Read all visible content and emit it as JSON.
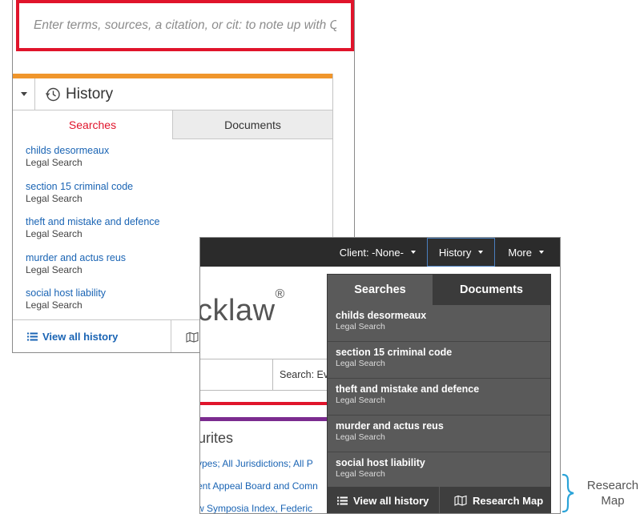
{
  "search": {
    "placeholder": "Enter terms, sources, a citation, or cit: to note up with Quic"
  },
  "history_panel": {
    "title": "History",
    "tabs": [
      {
        "label": "Searches",
        "active": true
      },
      {
        "label": "Documents",
        "active": false
      }
    ],
    "items": [
      {
        "name": "childs desormeaux",
        "type": "Legal Search"
      },
      {
        "name": "section 15 criminal code",
        "type": "Legal Search"
      },
      {
        "name": "theft and mistake and defence",
        "type": "Legal Search"
      },
      {
        "name": "murder and actus reus",
        "type": "Legal Search"
      },
      {
        "name": "social host liability",
        "type": "Legal Search"
      }
    ],
    "footer": {
      "view_all": "View all history"
    }
  },
  "header": {
    "client": "Client: -None-",
    "history": "History",
    "more": "More"
  },
  "background": {
    "logo_fragment": "cklaw",
    "logo_mark": "®",
    "search_scope": "Search: Ev",
    "favourites_title": "urites",
    "favourite_links": [
      "ypes; All Jurisdictions; All P",
      "ent Appeal Board and Comn",
      "w Symposia Index, Federic"
    ]
  },
  "dropdown": {
    "tabs": [
      {
        "label": "Searches",
        "active": true
      },
      {
        "label": "Documents",
        "active": false
      }
    ],
    "items": [
      {
        "name": "childs desormeaux",
        "type": "Legal Search"
      },
      {
        "name": "section 15 criminal code",
        "type": "Legal Search"
      },
      {
        "name": "theft and mistake and defence",
        "type": "Legal Search"
      },
      {
        "name": "murder and actus reus",
        "type": "Legal Search"
      },
      {
        "name": "social host liability",
        "type": "Legal Search"
      }
    ],
    "footer": {
      "view_all": "View all history",
      "research_map": "Research Map"
    }
  },
  "callout": {
    "line1": "Research",
    "line2": "Map"
  },
  "colors": {
    "accent_red": "#e0142b",
    "accent_orange": "#f0962c",
    "link_blue": "#1a64b4",
    "callout_brace": "#2aa3d8",
    "dark_nav": "#2b2b2b"
  },
  "icons": [
    "chevron-down-icon",
    "history-clock-icon",
    "list-icon",
    "research-map-icon"
  ]
}
